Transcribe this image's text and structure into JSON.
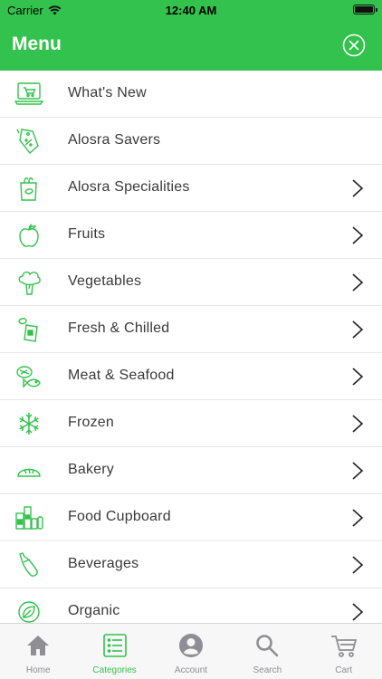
{
  "status_bar": {
    "carrier": "Carrier",
    "time": "12:40 AM"
  },
  "header": {
    "title": "Menu"
  },
  "menu": {
    "items": [
      {
        "label": "What's New",
        "icon": "shopping-laptop-icon",
        "has_chevron": false
      },
      {
        "label": "Alosra Savers",
        "icon": "price-tag-icon",
        "has_chevron": false
      },
      {
        "label": "Alosra Specialities",
        "icon": "grocery-bag-icon",
        "has_chevron": true
      },
      {
        "label": "Fruits",
        "icon": "apple-icon",
        "has_chevron": true
      },
      {
        "label": "Vegetables",
        "icon": "broccoli-icon",
        "has_chevron": true
      },
      {
        "label": "Fresh & Chilled",
        "icon": "chilled-pack-icon",
        "has_chevron": true
      },
      {
        "label": "Meat & Seafood",
        "icon": "steak-fish-icon",
        "has_chevron": true
      },
      {
        "label": "Frozen",
        "icon": "snowflake-icon",
        "has_chevron": true
      },
      {
        "label": "Bakery",
        "icon": "bread-icon",
        "has_chevron": true
      },
      {
        "label": "Food Cupboard",
        "icon": "pantry-jars-icon",
        "has_chevron": true
      },
      {
        "label": "Beverages",
        "icon": "bottle-icon",
        "has_chevron": true
      },
      {
        "label": "Organic",
        "icon": "leaf-icon",
        "has_chevron": true
      }
    ]
  },
  "tabbar": {
    "tabs": [
      {
        "label": "Home",
        "icon": "home-icon",
        "active": false
      },
      {
        "label": "Categories",
        "icon": "list-icon",
        "active": true
      },
      {
        "label": "Account",
        "icon": "account-icon",
        "active": false
      },
      {
        "label": "Search",
        "icon": "search-icon",
        "active": false
      },
      {
        "label": "Cart",
        "icon": "cart-icon",
        "active": false
      }
    ]
  },
  "colors": {
    "brand_green": "#33c24d",
    "tab_inactive": "#8e8e93",
    "text": "#3a3a3a"
  }
}
